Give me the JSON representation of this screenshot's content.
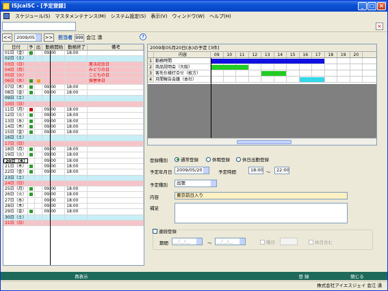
{
  "window": {
    "title": "ISJcalSC - [予定登録]"
  },
  "menu": [
    {
      "label": "スケジュール(S)"
    },
    {
      "label": "マスタメンテナンス(M)"
    },
    {
      "label": "システム設定(S)"
    },
    {
      "label": "表示(V)"
    },
    {
      "label": "ウィンドウ(W)"
    },
    {
      "label": "ヘルプ(H)"
    }
  ],
  "nav": {
    "prev": "<<",
    "month": "2009/05",
    "next": ">>",
    "tanto_label": "担当者",
    "tanto_id": "999",
    "tanto_name": "会江 湧"
  },
  "calendar": {
    "headers": [
      "日付",
      "予休",
      "出",
      "勤務開始",
      "勤務終了",
      "備考"
    ],
    "rows": [
      {
        "day": "01日（金）",
        "type": "",
        "k": "g",
        "h": "",
        "st": "09:00",
        "en": "18:00",
        "memo": ""
      },
      {
        "day": "02日（土）",
        "type": "sat",
        "k": "",
        "h": "",
        "st": "",
        "en": "",
        "memo": ""
      },
      {
        "day": "03日（日）",
        "type": "sun",
        "k": "",
        "h": "",
        "st": "",
        "en": "",
        "memo": "憲法記念日"
      },
      {
        "day": "04日（月）",
        "type": "sun",
        "k": "",
        "h": "",
        "st": "",
        "en": "",
        "memo": "みどりの日"
      },
      {
        "day": "05日（火）",
        "type": "sun",
        "k": "",
        "h": "",
        "st": "",
        "en": "",
        "memo": "こどもの日"
      },
      {
        "day": "06日（水）",
        "type": "sun",
        "k": "g",
        "h": "o",
        "st": "",
        "en": "",
        "memo": "振替休日"
      },
      {
        "day": "07日（木）",
        "type": "",
        "k": "g",
        "h": "",
        "st": "09:00",
        "en": "18:00",
        "memo": ""
      },
      {
        "day": "08日（金）",
        "type": "",
        "k": "g",
        "h": "",
        "st": "09:00",
        "en": "18:00",
        "memo": ""
      },
      {
        "day": "09日（土）",
        "type": "sat",
        "k": "",
        "h": "",
        "st": "",
        "en": "",
        "memo": ""
      },
      {
        "day": "10日（日）",
        "type": "sun",
        "k": "",
        "h": "",
        "st": "",
        "en": "",
        "memo": ""
      },
      {
        "day": "11日（月）",
        "type": "",
        "k": "r",
        "h": "",
        "st": "09:00",
        "en": "18:00",
        "memo": ""
      },
      {
        "day": "12日（火）",
        "type": "",
        "k": "g",
        "h": "",
        "st": "09:00",
        "en": "18:00",
        "memo": ""
      },
      {
        "day": "13日（水）",
        "type": "",
        "k": "g",
        "h": "",
        "st": "09:00",
        "en": "18:00",
        "memo": ""
      },
      {
        "day": "14日（木）",
        "type": "",
        "k": "g",
        "h": "",
        "st": "09:00",
        "en": "18:00",
        "memo": ""
      },
      {
        "day": "15日（金）",
        "type": "",
        "k": "g",
        "h": "",
        "st": "09:00",
        "en": "18:00",
        "memo": ""
      },
      {
        "day": "16日（土）",
        "type": "sat",
        "k": "",
        "h": "",
        "st": "",
        "en": "",
        "memo": ""
      },
      {
        "day": "17日（日）",
        "type": "sun",
        "k": "",
        "h": "",
        "st": "",
        "en": "",
        "memo": ""
      },
      {
        "day": "18日（月）",
        "type": "",
        "k": "g",
        "h": "",
        "st": "09:00",
        "en": "18:00",
        "memo": ""
      },
      {
        "day": "19日（火）",
        "type": "",
        "k": "g",
        "h": "",
        "st": "09:00",
        "en": "18:00",
        "memo": ""
      },
      {
        "day": "20日（水）",
        "type": "today",
        "k": "",
        "h": "",
        "st": "09:00",
        "en": "18:00",
        "memo": ""
      },
      {
        "day": "21日（木）",
        "type": "",
        "k": "g",
        "h": "",
        "st": "09:00",
        "en": "18:00",
        "memo": ""
      },
      {
        "day": "22日（金）",
        "type": "",
        "k": "g",
        "h": "",
        "st": "09:00",
        "en": "18:00",
        "memo": ""
      },
      {
        "day": "23日（土）",
        "type": "sat",
        "k": "",
        "h": "",
        "st": "",
        "en": "",
        "memo": ""
      },
      {
        "day": "24日（日）",
        "type": "sun",
        "k": "",
        "h": "",
        "st": "",
        "en": "",
        "memo": ""
      },
      {
        "day": "25日（月）",
        "type": "",
        "k": "g",
        "h": "",
        "st": "09:00",
        "en": "18:00",
        "memo": ""
      },
      {
        "day": "26日（火）",
        "type": "",
        "k": "g",
        "h": "",
        "st": "09:00",
        "en": "18:00",
        "memo": ""
      },
      {
        "day": "27日（水）",
        "type": "",
        "k": "",
        "h": "",
        "st": "09:00",
        "en": "18:00",
        "memo": ""
      },
      {
        "day": "28日（木）",
        "type": "",
        "k": "",
        "h": "",
        "st": "09:00",
        "en": "18:00",
        "memo": ""
      },
      {
        "day": "29日（金）",
        "type": "",
        "k": "g",
        "h": "",
        "st": "09:00",
        "en": "18:00",
        "memo": ""
      },
      {
        "day": "30日（土）",
        "type": "sat",
        "k": "",
        "h": "",
        "st": "",
        "en": "",
        "memo": ""
      },
      {
        "day": "31日（日）",
        "type": "sun",
        "k": "",
        "h": "",
        "st": "",
        "en": "",
        "memo": ""
      }
    ]
  },
  "gantt": {
    "title": "2009年05月20日(水)の予定 [3件]",
    "header_name": "内容",
    "hours": [
      "09",
      "10",
      "11",
      "12",
      "13",
      "14",
      "15",
      "16",
      "17",
      "18",
      "19",
      "20"
    ],
    "rows": [
      {
        "no": "1",
        "name": "勤務時間",
        "start": 9,
        "end": 18,
        "color": "#1010e0"
      },
      {
        "no": "2",
        "name": "商品説明会（大阪）",
        "start": 9,
        "end": 12,
        "color": "#22cc22"
      },
      {
        "no": "3",
        "name": "客先仕様打合せ（枚方）",
        "start": 13,
        "end": 15,
        "color": "#22cc22"
      },
      {
        "no": "4",
        "name": "月間報告会議（本社）",
        "start": 16,
        "end": 18,
        "color": "#33d8e8"
      }
    ]
  },
  "form": {
    "reg_label": "登録種別",
    "radios": [
      "通常登録",
      "休暇登録",
      "休日出勤登録"
    ],
    "date_label": "予定年月日",
    "date_value": "2009/05/20",
    "time_label": "予定時間",
    "time_start": "18:00",
    "time_sep": "〜",
    "time_end": "22:00",
    "kind_label": "予定種別",
    "kind_value": "出張",
    "content_label": "内容",
    "content_value": "東京前日入り",
    "note_label": "補足",
    "repeat_label": "連続登録",
    "period_label": "期間",
    "period_from": "__/__/__",
    "period_to": "__/__/__",
    "every_label": "曜日",
    "holiday_label": "休日含む"
  },
  "footer": {
    "show": "再表示",
    "register": "登 録",
    "close": "閉じる"
  },
  "status": {
    "company": "株式会社アイエスジェイ 会江 湧"
  }
}
